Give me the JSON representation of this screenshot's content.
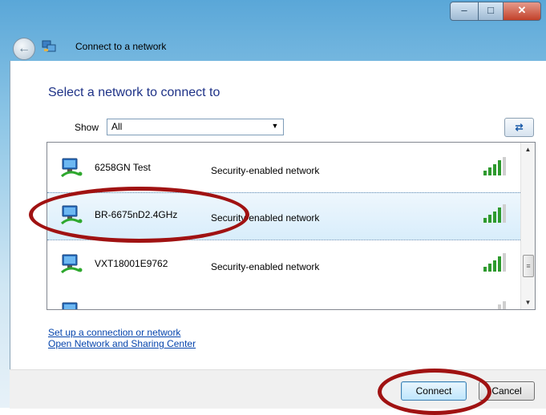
{
  "window": {
    "title": "Connect to a network",
    "controls": {
      "minimize": "–",
      "maximize": "□",
      "close": "✕"
    },
    "back_icon": "back-arrow-icon"
  },
  "main": {
    "heading": "Select a network to connect to",
    "show_label": "Show",
    "show_value": "All",
    "refresh_icon": "refresh-icon"
  },
  "networks": [
    {
      "name": "6258GN Test",
      "security": "Security-enabled network",
      "selected": false
    },
    {
      "name": "BR-6675nD2.4GHz",
      "security": "Security-enabled network",
      "selected": true
    },
    {
      "name": "VXT18001E9762",
      "security": "Security-enabled network",
      "selected": false
    }
  ],
  "links": {
    "setup": "Set up a connection or network",
    "center": "Open Network and Sharing Center"
  },
  "buttons": {
    "connect": "Connect",
    "cancel": "Cancel"
  },
  "colors": {
    "heading": "#1e3287",
    "link": "#0645ad",
    "highlight": "#a01212",
    "signal": "#2e9a2e"
  }
}
